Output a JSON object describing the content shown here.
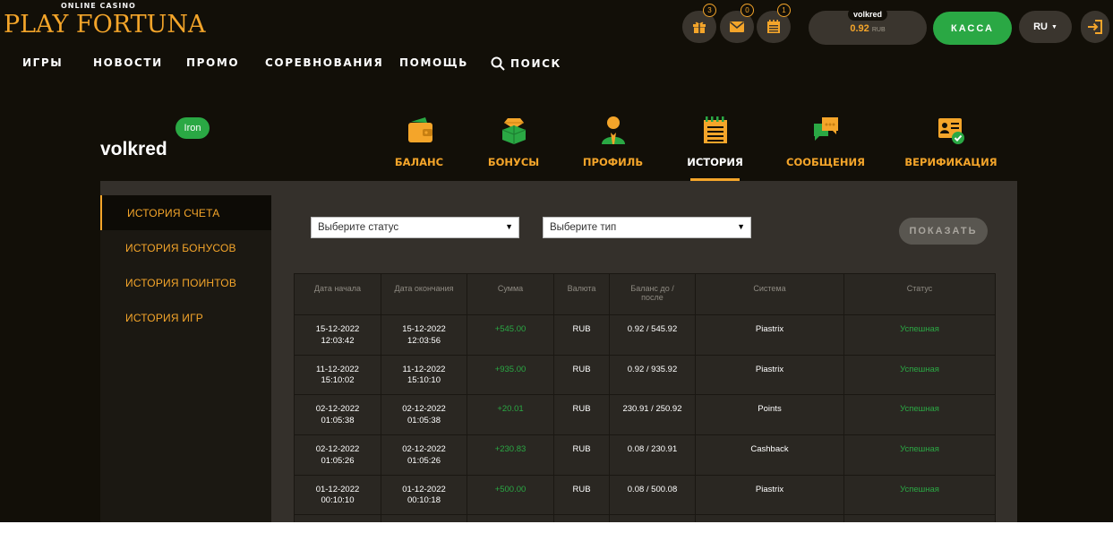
{
  "brand": {
    "sub": "ONLINE CASINO",
    "name": "PLAY FORTUNA"
  },
  "header": {
    "gift_count": "3",
    "mail_count": "0",
    "calendar_count": "1",
    "username": "volkred",
    "balance": "0.92",
    "currency": "RUB",
    "kassa_label": "КАССА",
    "language": "RU"
  },
  "nav": {
    "items": [
      "ИГРЫ",
      "НОВОСТИ",
      "ПРОМО",
      "СОРЕВНОВАНИЯ",
      "ПОМОЩЬ",
      "ПОИСК"
    ]
  },
  "profile": {
    "username": "volkred",
    "level": "Iron",
    "tabs": [
      "БАЛАНС",
      "БОНУСЫ",
      "ПРОФИЛЬ",
      "ИСТОРИЯ",
      "СООБЩЕНИЯ",
      "ВЕРИФИКАЦИЯ"
    ],
    "active_tab": "ИСТОРИЯ"
  },
  "sidenav": {
    "items": [
      "ИСТОРИЯ СЧЕТА",
      "ИСТОРИЯ БОНУСОВ",
      "ИСТОРИЯ ПОИНТОВ",
      "ИСТОРИЯ ИГР"
    ],
    "active": "ИСТОРИЯ СЧЕТА"
  },
  "filters": {
    "status_value": "Выберите статус",
    "type_value": "Выберите тип",
    "show_label": "ПОКАЗАТЬ"
  },
  "table": {
    "headers": [
      "Дата начала",
      "Дата окончания",
      "Сумма",
      "Валюта",
      "Баланс до / после",
      "Система",
      "Статус"
    ],
    "rows": [
      {
        "start_date": "15-12-2022",
        "start_time": "12:03:42",
        "end_date": "15-12-2022",
        "end_time": "12:03:56",
        "amount": "+545.00",
        "currency": "RUB",
        "balance": "0.92 / 545.92",
        "system": "Piastrix",
        "status": "Успешная"
      },
      {
        "start_date": "11-12-2022",
        "start_time": "15:10:02",
        "end_date": "11-12-2022",
        "end_time": "15:10:10",
        "amount": "+935.00",
        "currency": "RUB",
        "balance": "0.92 / 935.92",
        "system": "Piastrix",
        "status": "Успешная"
      },
      {
        "start_date": "02-12-2022",
        "start_time": "01:05:38",
        "end_date": "02-12-2022",
        "end_time": "01:05:38",
        "amount": "+20.01",
        "currency": "RUB",
        "balance": "230.91 / 250.92",
        "system": "Points",
        "status": "Успешная"
      },
      {
        "start_date": "02-12-2022",
        "start_time": "01:05:26",
        "end_date": "02-12-2022",
        "end_time": "01:05:26",
        "amount": "+230.83",
        "currency": "RUB",
        "balance": "0.08 / 230.91",
        "system": "Cashback",
        "status": "Успешная"
      },
      {
        "start_date": "01-12-2022",
        "start_time": "00:10:10",
        "end_date": "01-12-2022",
        "end_time": "00:10:18",
        "amount": "+500.00",
        "currency": "RUB",
        "balance": "0.08 / 500.08",
        "system": "Piastrix",
        "status": "Успешная"
      }
    ]
  },
  "colors": {
    "accent": "#f4a52a",
    "success": "#2aa844",
    "background": "#120f08",
    "panel": "#34302b"
  }
}
